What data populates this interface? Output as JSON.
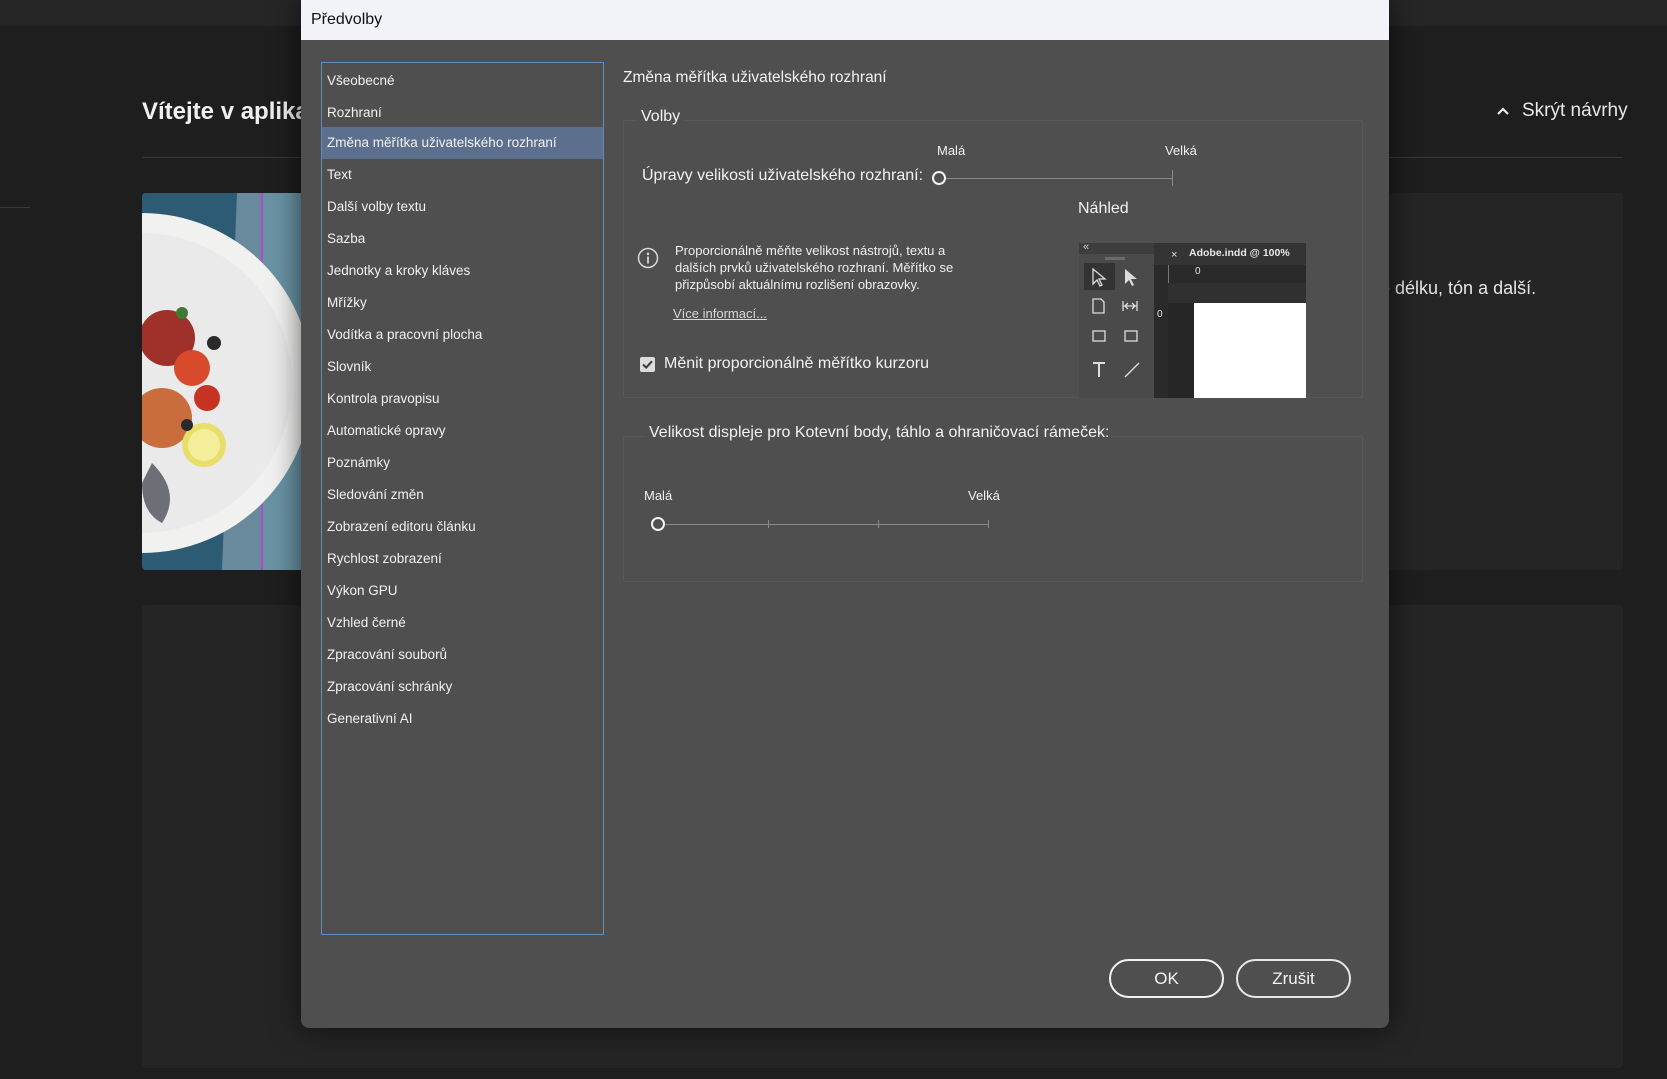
{
  "background": {
    "welcome_title": "Vítejte v aplikaci",
    "hide_suggestions": "Skrýt návrhy",
    "card_text": "e délku, tón a další."
  },
  "dialog": {
    "title": "Předvolby",
    "categories": [
      "Všeobecné",
      "Rozhraní",
      "Změna měřítka uživatelského rozhraní",
      "Text",
      "Další volby textu",
      "Sazba",
      "Jednotky a kroky kláves",
      "Mřížky",
      "Vodítka a pracovní plocha",
      "Slovník",
      "Kontrola pravopisu",
      "Automatické opravy",
      "Poznámky",
      "Sledování změn",
      "Zobrazení editoru článku",
      "Rychlost zobrazení",
      "Výkon GPU",
      "Vzhled černé",
      "Zpracování souborů",
      "Zpracování schránky",
      "Generativní AI"
    ],
    "selected_category": "Změna měřítka uživatelského rozhraní",
    "pane_title": "Změna měřítka uživatelského rozhraní",
    "volby": {
      "legend": "Volby",
      "slider_label": "Úpravy velikosti uživatelského rozhraní:",
      "min_label": "Malá",
      "max_label": "Velká",
      "slider_value": 0,
      "info_text": "Proporcionálně měňte velikost nástrojů, textu a dalších prvků uživatelského rozhraní. Měřítko se přizpůsobí aktuálnímu rozlišení obrazovky.",
      "more_link": "Více informací...",
      "checkbox_label": "Měnit proporcionálně měřítko kurzoru",
      "checkbox_checked": true,
      "preview_title": "Náhled",
      "preview_doc_tab": "Adobe.indd @ 100%",
      "preview_collapse": "«",
      "preview_ruler_zero": "0"
    },
    "anchor": {
      "legend": "Velikost displeje pro Kotevní body, táhlo a ohraničovací rámeček:",
      "min_label": "Malá",
      "max_label": "Velká",
      "slider_value": 0
    },
    "buttons": {
      "ok": "OK",
      "cancel": "Zrušit"
    }
  }
}
